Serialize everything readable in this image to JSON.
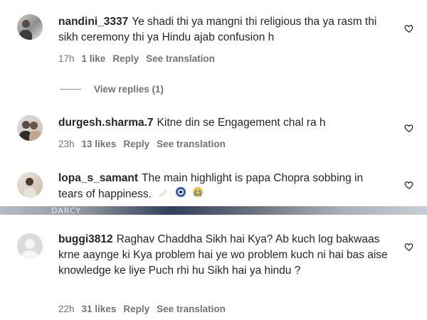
{
  "comments": [
    {
      "username": "nandini_3337",
      "text": "Ye shadi thi ya mangni thi religious tha ya rasm thi sikh ceremony thi ya Hindu ajab confusion h",
      "time": "17h",
      "likes": "1 like",
      "reply": "Reply",
      "translate": "See translation",
      "view_replies": "View replies (1)"
    },
    {
      "username": "durgesh.sharma.7",
      "text": "Kitne din se Engagement chal ra h",
      "time": "23h",
      "likes": "13 likes",
      "reply": "Reply",
      "translate": "See translation"
    },
    {
      "username": "lopa_s_samant",
      "text": "The main highlight is papa Chopra sobbing in tears of happiness.",
      "time": "",
      "likes": "",
      "reply": "",
      "translate": ""
    },
    {
      "username": "buggi3812",
      "text": "Raghav Chaddha Sikh hai Kya? Ab kuch log bakwaas krne aaynge ki Kya problem hai ye wo problem kuch ni hai bas aise knowledge ke liye Puch rhi hu Sikh hai ya hindu ?",
      "time": "22h",
      "likes": "31 likes",
      "reply": "Reply",
      "translate": "See translation"
    }
  ],
  "strip_text": "DARCY",
  "icons": {
    "like": "heart-outline-icon",
    "emoji_hand": "folded-hands-emoji",
    "emoji_eye": "eye-emoji",
    "emoji_face": "crying-face-emoji"
  },
  "colors": {
    "text": "#262626",
    "meta": "#737373"
  }
}
